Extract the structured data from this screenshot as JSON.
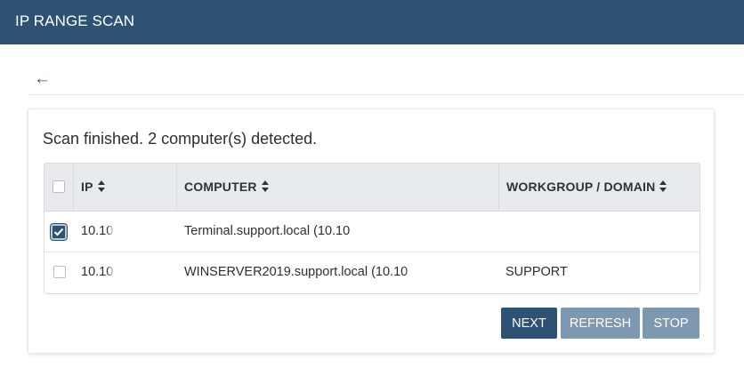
{
  "header": {
    "title": "IP RANGE SCAN"
  },
  "nav": {
    "back_icon": "left-arrow-icon"
  },
  "scan": {
    "status": "Scan finished. 2 computer(s) detected."
  },
  "table": {
    "columns": {
      "ip": "IP",
      "computer": "COMPUTER",
      "workgroup": "WORKGROUP / DOMAIN"
    },
    "rows": [
      {
        "checked": true,
        "ip": "10.10",
        "computer": "Terminal.support.local (10.10",
        "workgroup": ""
      },
      {
        "checked": false,
        "ip": "10.10",
        "computer": "WINSERVER2019.support.local (10.10",
        "workgroup": "SUPPORT"
      }
    ]
  },
  "actions": {
    "next": "NEXT",
    "refresh": "REFRESH",
    "stop": "STOP"
  },
  "colors": {
    "header_bg": "#2e5274",
    "primary_button": "#2e5274",
    "disabled_button": "#7f98b1"
  }
}
